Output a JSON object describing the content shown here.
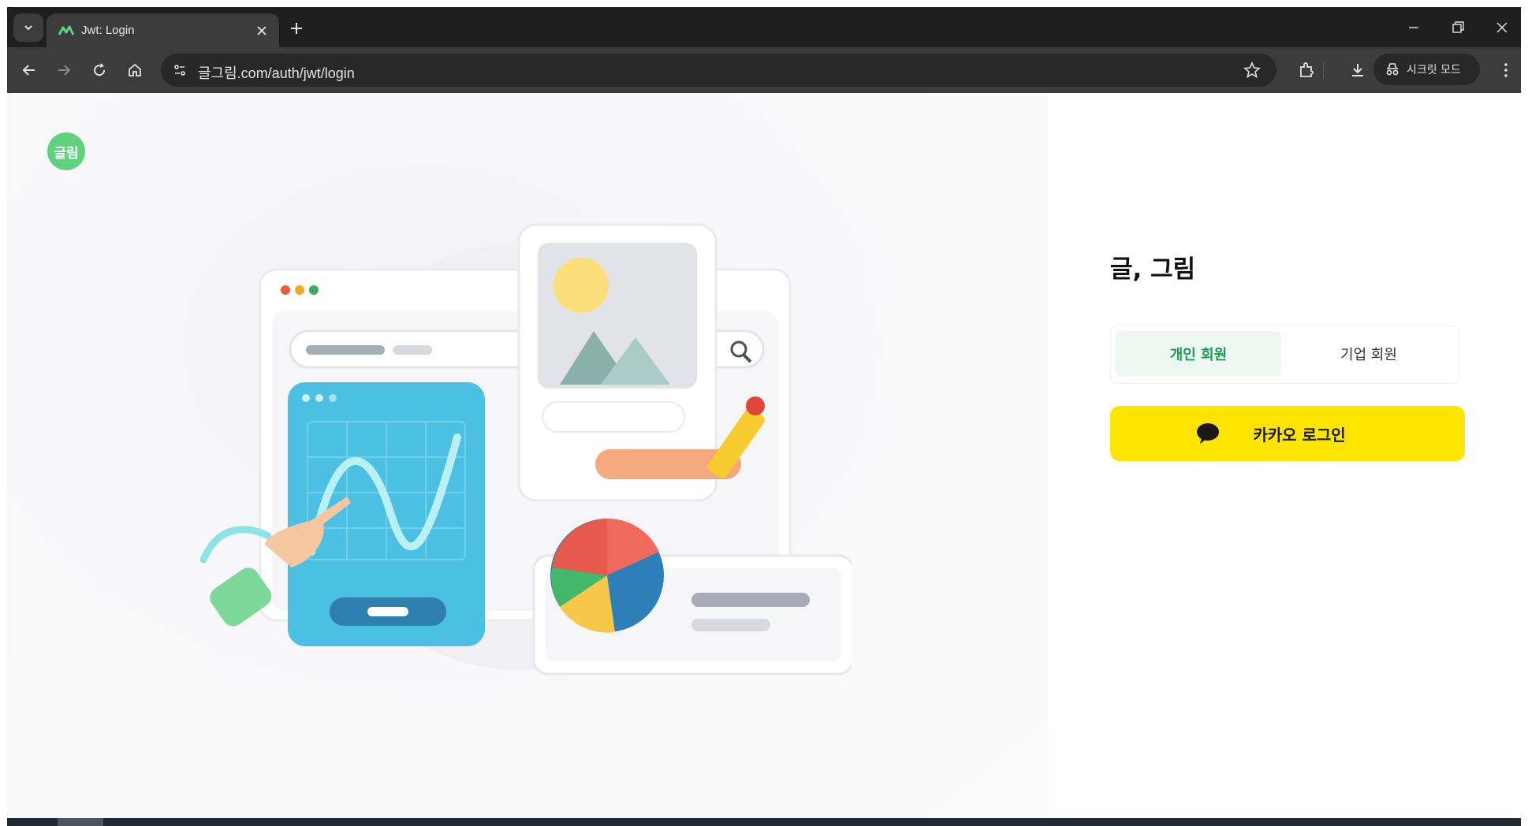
{
  "browser": {
    "tab": {
      "title": "Jwt: Login"
    },
    "address": {
      "url": "글그림.com/auth/jwt/login"
    },
    "incognito_label": "시크릿 모드"
  },
  "page": {
    "logo_text": "글림",
    "title": "글, 그림",
    "member_tabs": [
      {
        "label": "개인 회원",
        "active": true
      },
      {
        "label": "기업 회원",
        "active": false
      }
    ],
    "kakao_login_label": "카카오 로그인"
  },
  "colors": {
    "brand_green": "#5fd27e",
    "kakao_yellow": "#fee500",
    "active_tab_text": "#1f9a52"
  }
}
